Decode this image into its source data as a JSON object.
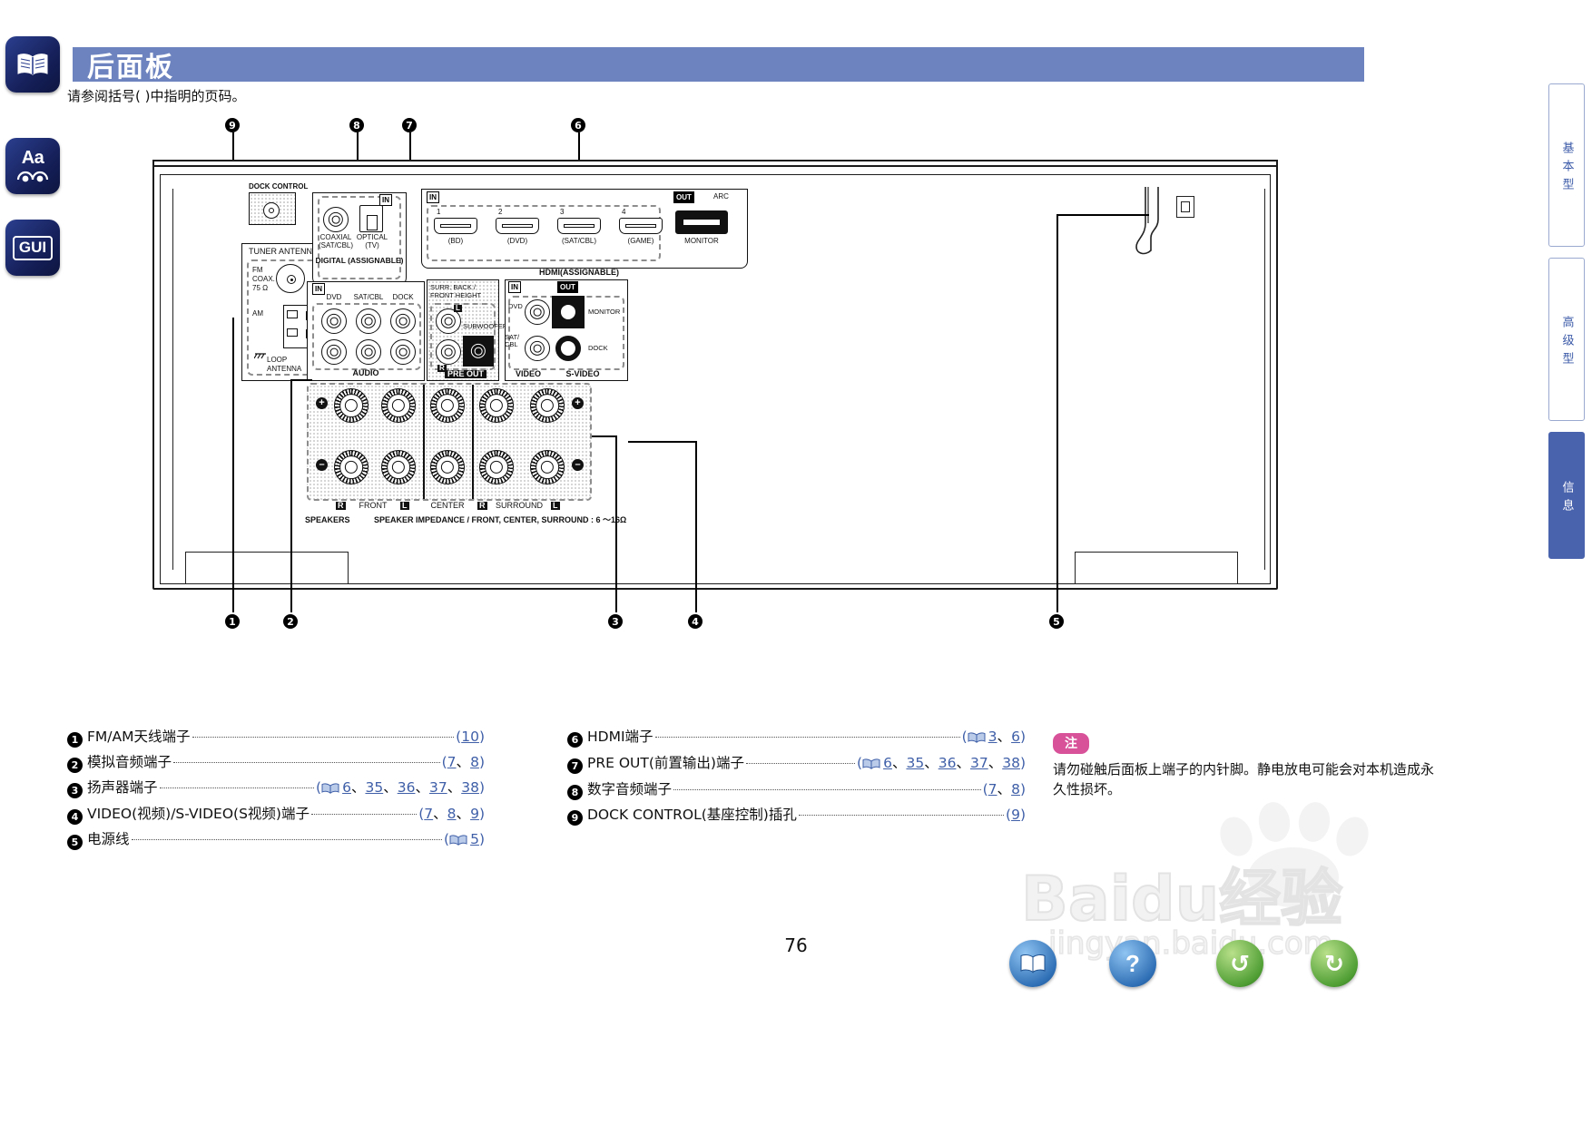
{
  "page": {
    "title": "后面板",
    "subtitle": "请参阅括号(  )中指明的页码。",
    "number": "76",
    "header_color": "#6c83c0"
  },
  "left_rail": [
    {
      "name": "book-icon",
      "glyph": "book"
    },
    {
      "name": "font-size-icon",
      "glyph": "Aa"
    },
    {
      "name": "gui-icon",
      "glyph": "GUI"
    }
  ],
  "side_tabs": [
    {
      "label": "基本型",
      "active": false
    },
    {
      "label": "高级型",
      "active": false
    },
    {
      "label": "信息",
      "active": true
    }
  ],
  "callouts": [
    "1",
    "2",
    "3",
    "4",
    "5",
    "6",
    "7",
    "8",
    "9"
  ],
  "diagram": {
    "dock_control": "DOCK CONTROL",
    "tuner_antenna": "TUNER ANTENNA",
    "fm_coax": "FM\nCOAX.\n75 Ω",
    "am": "AM",
    "loop_antenna": "LOOP\nANTENNA",
    "digital_assignable": "DIGITAL  (ASSIGNABLE)",
    "coaxial": "COAXIAL",
    "coaxial_sub": "(SAT/CBL)",
    "optical": "OPTICAL",
    "optical_sub": "(TV)",
    "in_badge": "IN",
    "out_badge": "OUT",
    "arc": "ARC",
    "hdmi_group": "HDMI(ASSIGNABLE)",
    "hdmi_ports": [
      {
        "num": "1",
        "label": "(BD)"
      },
      {
        "num": "2",
        "label": "(DVD)"
      },
      {
        "num": "3",
        "label": "(SAT/CBL)"
      },
      {
        "num": "4",
        "label": "(GAME)"
      }
    ],
    "hdmi_monitor": "MONITOR",
    "audio_group": "AUDIO",
    "audio_inputs": [
      "DVD",
      "SAT/CBL",
      "DOCK"
    ],
    "preout_group": "PRE OUT",
    "preout_surr": "SURR. BACK /\nFRONT HEIGHT",
    "preout_sub": "SUBWOOFER",
    "preout_L": "L",
    "preout_R": "R",
    "video_group": "VIDEO",
    "svideo_group": "S-VIDEO",
    "video_inputs": [
      "DVD",
      "SAT/\nCBL"
    ],
    "video_outputs": [
      "MONITOR",
      "DOCK"
    ],
    "speakers_label": "SPEAKERS",
    "speaker_impedance": "SPEAKER IMPEDANCE / FRONT, CENTER, SURROUND : 6 ～16Ω",
    "speaker_groups": [
      {
        "left": "R",
        "name": "FRONT",
        "right": "L"
      },
      {
        "left": "",
        "name": "CENTER",
        "right": ""
      },
      {
        "left": "R",
        "name": "SURROUND",
        "right": "L"
      }
    ],
    "polarity_plus": "+",
    "polarity_minus": "–"
  },
  "legend_left": [
    {
      "num": "1",
      "text": "FM/AM天线端子",
      "book": false,
      "pages": [
        "10"
      ]
    },
    {
      "num": "2",
      "text": "模拟音频端子",
      "book": false,
      "pages": [
        "7",
        "8"
      ]
    },
    {
      "num": "3",
      "text": "扬声器端子",
      "book": true,
      "pages": [
        "6",
        "35",
        "36",
        "37",
        "38"
      ]
    },
    {
      "num": "4",
      "text": "VIDEO(视频)/S-VIDEO(S视频)端子",
      "book": false,
      "pages": [
        "7",
        "8",
        "9"
      ]
    },
    {
      "num": "5",
      "text": "电源线",
      "book": true,
      "pages": [
        "5"
      ]
    }
  ],
  "legend_right": [
    {
      "num": "6",
      "text": "HDMI端子",
      "book": true,
      "pages": [
        "3",
        "6"
      ]
    },
    {
      "num": "7",
      "text": "PRE OUT(前置输出)端子",
      "book": true,
      "pages": [
        "6",
        "35",
        "36",
        "37",
        "38"
      ]
    },
    {
      "num": "8",
      "text": "数字音频端子",
      "book": false,
      "pages": [
        "7",
        "8"
      ]
    },
    {
      "num": "9",
      "text": "DOCK CONTROL(基座控制)插孔",
      "book": false,
      "pages": [
        "9"
      ]
    }
  ],
  "note": {
    "badge": "注",
    "badge_color": "#d8529a",
    "body": "请勿碰触后面板上端子的内针脚。静电放电可能会对本机造成永久性损坏。"
  },
  "footer_buttons": [
    {
      "name": "manual-book-button",
      "glyph": "book",
      "color": "blue"
    },
    {
      "name": "help-button",
      "glyph": "?",
      "color": "blue"
    },
    {
      "name": "back-button",
      "glyph": "↺",
      "color": "green"
    },
    {
      "name": "forward-button",
      "glyph": "↻",
      "color": "green"
    }
  ],
  "watermark": {
    "line1": "Baidu经验",
    "line2": "jingyan.baidu.com"
  }
}
